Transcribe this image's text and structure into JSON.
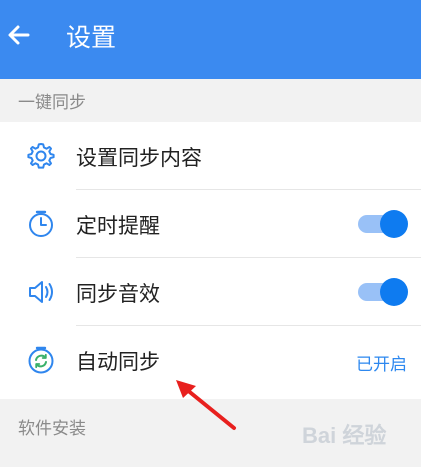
{
  "header": {
    "title": "设置",
    "back_icon": "arrow-left-icon"
  },
  "sections": [
    {
      "title": "一键同步"
    },
    {
      "title": "软件安装"
    }
  ],
  "items": [
    {
      "label": "设置同步内容",
      "icon": "gear-icon"
    },
    {
      "label": "定时提醒",
      "icon": "timer-icon",
      "toggle": true
    },
    {
      "label": "同步音效",
      "icon": "speaker-icon",
      "toggle": true
    },
    {
      "label": "自动同步",
      "icon": "sync-icon",
      "status": "已开启"
    }
  ],
  "colors": {
    "header": "#3b8af0",
    "accent": "#0e7bf0",
    "status": "#2d88ef",
    "annotation_arrow": "#e8201e"
  },
  "watermark": "Bai 经验"
}
